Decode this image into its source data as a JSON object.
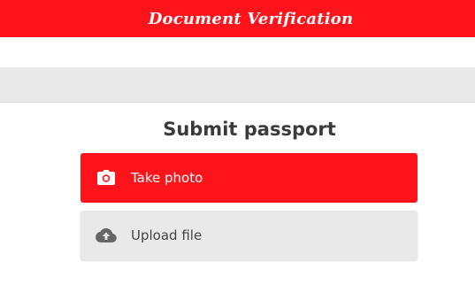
{
  "header": {
    "title": "Document Verification",
    "background_color": "#ff141c"
  },
  "main": {
    "section_title": "Submit passport",
    "options": [
      {
        "label": "Take photo",
        "icon": "camera-icon",
        "background_color": "#ff141c"
      },
      {
        "label": "Upload file",
        "icon": "cloud-upload-icon",
        "background_color": "#e9e9e9"
      }
    ]
  }
}
